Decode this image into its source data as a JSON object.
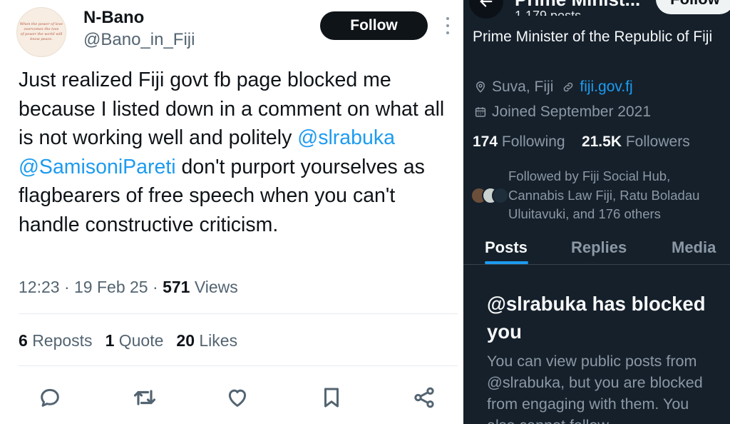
{
  "tweet": {
    "avatar_text": [
      "When the power of love",
      "overcomes the love",
      "of power the world will",
      "know peace."
    ],
    "display_name": "N-Bano",
    "handle": "@Bano_in_Fiji",
    "follow_label": "Follow",
    "text_before": "Just realized Fiji govt fb page blocked me because I listed down in a comment on what all is not working well and politely ",
    "mention1": "@slrabuka",
    "space": " ",
    "mention2": "@SamisoniPareti",
    "text_after": " don't purport yourselves as flagbearers of free speech when you can't handle constructive criticism.",
    "time": "12:23",
    "sep": "·",
    "date": "19 Feb 25",
    "views_count": "571",
    "views_label": "Views",
    "reposts_count": "6",
    "reposts_label": "Reposts",
    "quotes_count": "1",
    "quotes_label": "Quote",
    "likes_count": "20",
    "likes_label": "Likes",
    "icons": [
      "reply-icon",
      "repost-icon",
      "like-icon",
      "bookmark-icon",
      "share-icon"
    ]
  },
  "profile": {
    "header_title": "Prime Minist...",
    "header_sub": "1,179 posts",
    "follow_label": "Follow",
    "bio": "Prime Minister of the Republic of Fiji",
    "location": "Suva, Fiji",
    "website": "fiji.gov.fj",
    "joined": "Joined September 2021",
    "following_count": "174",
    "following_label": "Following",
    "followers_count": "21.5K",
    "followers_label": "Followers",
    "followed_by": "Followed by Fiji Social Hub, Cannabis Law Fiji, Ratu Boladau Uluitavuki, and 176 others",
    "tabs": [
      "Posts",
      "Replies",
      "Media"
    ],
    "active_tab": "Posts",
    "blocked_title": "@slrabuka has blocked you",
    "blocked_body": "You can view public posts from @slrabuka, but you are blocked from engaging with them. You also cannot follow"
  },
  "colors": {
    "accent": "#1d9bf0",
    "dark_bg": "#15202b",
    "light_text": "#0f1419",
    "muted": "#536471"
  }
}
